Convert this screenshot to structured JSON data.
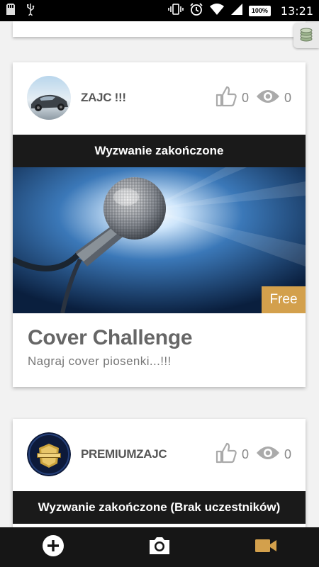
{
  "status_bar": {
    "time": "13:21",
    "battery": "100%",
    "icons": [
      "sd-card-icon",
      "usb-icon",
      "vibrate-icon",
      "alarm-icon",
      "wifi-icon",
      "signal-icon",
      "battery-icon"
    ]
  },
  "cards": [
    {
      "username": "ZAJC !!!",
      "likes": "0",
      "views": "0",
      "banner": "Wyzwanie zakończone",
      "badge": "Free",
      "title": "Cover Challenge",
      "description": "Nagraj cover piosenki...!!!"
    },
    {
      "username": "PREMIUMZAJC",
      "likes": "0",
      "views": "0",
      "banner": "Wyzwanie zakończone (Brak uczestników)"
    }
  ],
  "bottom_nav": {
    "items": [
      "add-icon",
      "camera-icon",
      "video-camera-icon"
    ],
    "active": "video-camera-icon",
    "accent": "#d3a04c"
  },
  "colors": {
    "banner": "#1a1a1a",
    "badge": "#d3a04c",
    "nav": "#161616"
  }
}
